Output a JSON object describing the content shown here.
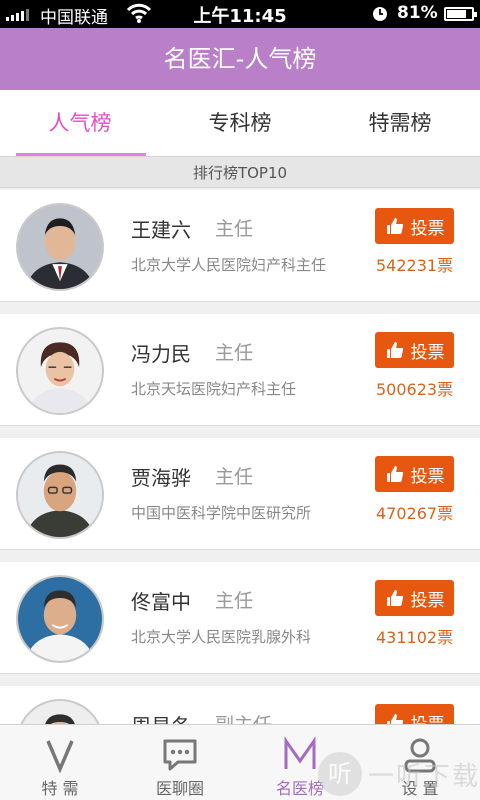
{
  "status_bar": {
    "carrier": "中国联通",
    "time": "上午11:45",
    "battery_percent": "81%",
    "battery_level": 0.81,
    "icons": [
      "signal-icon",
      "wifi-icon",
      "alarm-icon",
      "battery-icon"
    ]
  },
  "header": {
    "title": "名医汇-人气榜"
  },
  "tabs": [
    {
      "label": "人气榜",
      "active": true
    },
    {
      "label": "专科榜",
      "active": false
    },
    {
      "label": "特需榜",
      "active": false
    }
  ],
  "section_title": "排行榜TOP10",
  "doctors": [
    {
      "name": "王建六",
      "title": "主任",
      "hospital": "北京大学人民医院妇产科主任",
      "vote_label": "投票",
      "votes": "542231票"
    },
    {
      "name": "冯力民",
      "title": "主任",
      "hospital": "北京天坛医院妇产科主任",
      "vote_label": "投票",
      "votes": "500623票"
    },
    {
      "name": "贾海骅",
      "title": "主任",
      "hospital": "中国中医科学院中医研究所",
      "vote_label": "投票",
      "votes": "470267票"
    },
    {
      "name": "佟富中",
      "title": "主任",
      "hospital": "北京大学人民医院乳腺外科",
      "vote_label": "投票",
      "votes": "431102票"
    },
    {
      "name": "周易冬",
      "title": "副主任",
      "hospital": "",
      "vote_label": "投票",
      "votes": ""
    }
  ],
  "bottom_nav": [
    {
      "label": "特 需",
      "icon": "v-icon",
      "active": false
    },
    {
      "label": "医聊圈",
      "icon": "chat-icon",
      "active": false
    },
    {
      "label": "名医榜",
      "icon": "m-icon",
      "active": true
    },
    {
      "label": "设 置",
      "icon": "person-icon",
      "active": false
    }
  ],
  "watermark": {
    "logo": "听",
    "text": "一听下载"
  },
  "colors": {
    "header": "#b97fc9",
    "active_tab": "#e04fc4",
    "vote_button": "#e8570f",
    "vote_count": "#d8641c",
    "nav_active": "#a56ac2"
  }
}
